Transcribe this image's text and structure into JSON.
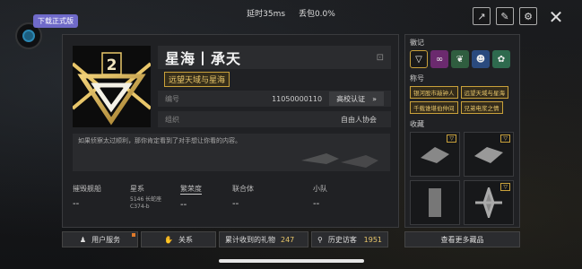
{
  "status": {
    "latency": "延时35ms",
    "packet_loss": "丢包0.0%"
  },
  "download_badge": "下载正式版",
  "profile": {
    "name": "星海丨承天",
    "title_badge": "远望天域与星海",
    "rank_number": "2",
    "id_label": "编号",
    "id_value": "11050000110",
    "cert_label": "高校认证",
    "org_label": "组织",
    "org_value": "自由人协会",
    "signature": "如果侦察太过顺利，那你肯定看到了对手想让你看的内容。"
  },
  "stats": {
    "destroyed": {
      "label": "摧毁舰船",
      "value": "--"
    },
    "galaxy": {
      "label": "星系",
      "line1": "5146 长蛇座",
      "line2": "C374-b"
    },
    "prosperity": {
      "label": "繁荣度",
      "value": "--"
    },
    "union": {
      "label": "联合体",
      "value": "--"
    },
    "squad": {
      "label": "小队",
      "value": "--"
    }
  },
  "right": {
    "badges_heading": "徽记",
    "titles_heading": "称号",
    "collection_heading": "收藏",
    "titles": [
      "银河股市敲钟人",
      "远望天域与星海",
      "千载谁堪伯仲间",
      "兄弟电浆之情"
    ],
    "badges": [
      {
        "icon": "rank-emblem-icon",
        "color": "#1a1a1a"
      },
      {
        "icon": "chain-icon",
        "color": "#6b2a6e"
      },
      {
        "icon": "wreath-icon",
        "color": "#2f5d3f"
      },
      {
        "icon": "face-icon",
        "color": "#2a4a7e"
      },
      {
        "icon": "sprout-icon",
        "color": "#2e6a4e"
      }
    ]
  },
  "bottom": {
    "user_service": "用户服务",
    "relations": "关系",
    "gifts_label": "累计收到的礼物",
    "gifts_count": "247",
    "visitors_label": "历史访客",
    "visitors_count": "1951",
    "more_collection": "查看更多藏品"
  },
  "colors": {
    "accent_gold": "#c9a13b",
    "panel": "#202124"
  }
}
